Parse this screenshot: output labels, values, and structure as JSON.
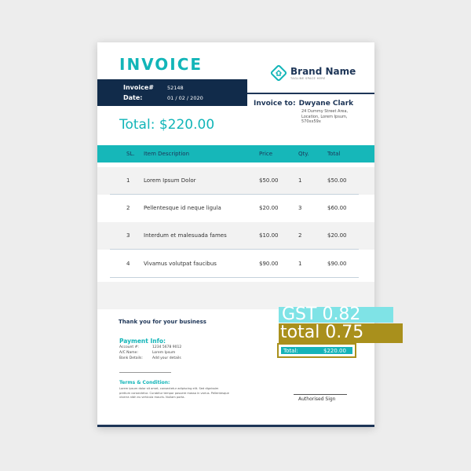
{
  "invoice": {
    "title": "INVOICE",
    "meta": {
      "number_label": "Invoice#",
      "number_value": "52148",
      "date_label": "Date:",
      "date_value": "01 / 02 / 2020"
    },
    "brand": {
      "name": "Brand Name",
      "tagline": "TAGLINE SPACE HERE",
      "logo_icon": "diamond-house-icon"
    },
    "bill_to": {
      "label": "Invoice to:",
      "name": "Dwyane Clark",
      "address": "24 Dummy Street Area, Location, Lorem Ipsum, 570xx59x"
    },
    "total_banner": "Total: $220.00",
    "table": {
      "headers": [
        "SL.",
        "Item Description",
        "Price",
        "Qty.",
        "Total"
      ],
      "rows": [
        [
          "1",
          "Lorem Ipsum Dolor",
          "$50.00",
          "1",
          "$50.00"
        ],
        [
          "2",
          "Pellentesque id neque ligula",
          "$20.00",
          "3",
          "$60.00"
        ],
        [
          "3",
          "Interdum et malesuada fames",
          "$10.00",
          "2",
          "$20.00"
        ],
        [
          "4",
          "Vivamus volutpat faucibus",
          "$90.00",
          "1",
          "$90.00"
        ]
      ]
    },
    "thanks": "Thank you for your business",
    "payment": {
      "title": "Payment Info:",
      "rows": [
        {
          "label": "Account #:",
          "value": "1234 5678 9012"
        },
        {
          "label": "A/C Name:",
          "value": "Lorem Ipsum"
        },
        {
          "label": "Bank Details:",
          "value": "Add your details"
        }
      ]
    },
    "terms": {
      "title": "Terms & Condition:",
      "text": "Lorem ipsum dolor sit amet, consectetur adipiscing elit. Sed dignissim pretium consectetur. Curabitur tempor posuere massa in varius. Pellentesque viverra nibh eu vehicula mauris. Nullam porta."
    },
    "signature_label": "Authorised Sign",
    "summary": {
      "gst_text": "GST 0.82",
      "total_text": "total 0.75",
      "final_label": "Total:",
      "final_value": "$220.00"
    }
  },
  "colors": {
    "teal": "#12b5b8",
    "navy": "#112b4a",
    "annotation_cyan": "#7fe3e6",
    "annotation_olive": "#a9901c"
  }
}
